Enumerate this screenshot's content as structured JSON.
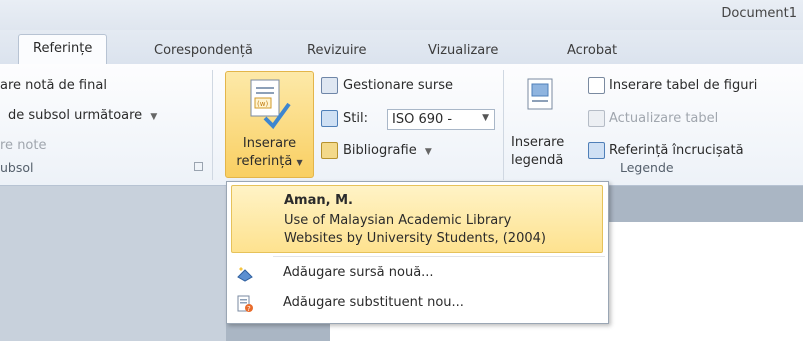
{
  "window": {
    "title": "Document1"
  },
  "tabs": [
    "Referințe",
    "Corespondență",
    "Revizuire",
    "Vizualizare",
    "Acrobat"
  ],
  "ribbon": {
    "footnotes": {
      "insert_endnote": "are notă de final",
      "next_footnote": "de subsol următoare",
      "show_notes": "re note",
      "group_label": "ubsol"
    },
    "citations": {
      "insert_citation_line1": "Inserare",
      "insert_citation_line2": "referință",
      "manage_sources": "Gestionare surse",
      "style_label": "Stil:",
      "style_value": "ISO 690 -",
      "bibliography": "Bibliografie"
    },
    "captions": {
      "insert_caption_line1": "Inserare",
      "insert_caption_line2": "legendă",
      "insert_table_of_figures": "Inserare tabel de figuri",
      "update_table": "Actualizare tabel",
      "cross_reference": "Referință încrucișată",
      "group_label": "Legende"
    }
  },
  "dropdown": {
    "source": {
      "author": "Aman, M.",
      "title_line1": "Use of Malaysian Academic Library",
      "title_line2": "Websites by University Students, (2004)"
    },
    "add_new_source": "Adăugare sursă nouă...",
    "add_new_placeholder": "Adăugare substituent nou..."
  },
  "colors": {
    "highlight": "#fee28f",
    "ribbon_bg": "#edf2f8",
    "accent_blue": "#2b63b5"
  }
}
